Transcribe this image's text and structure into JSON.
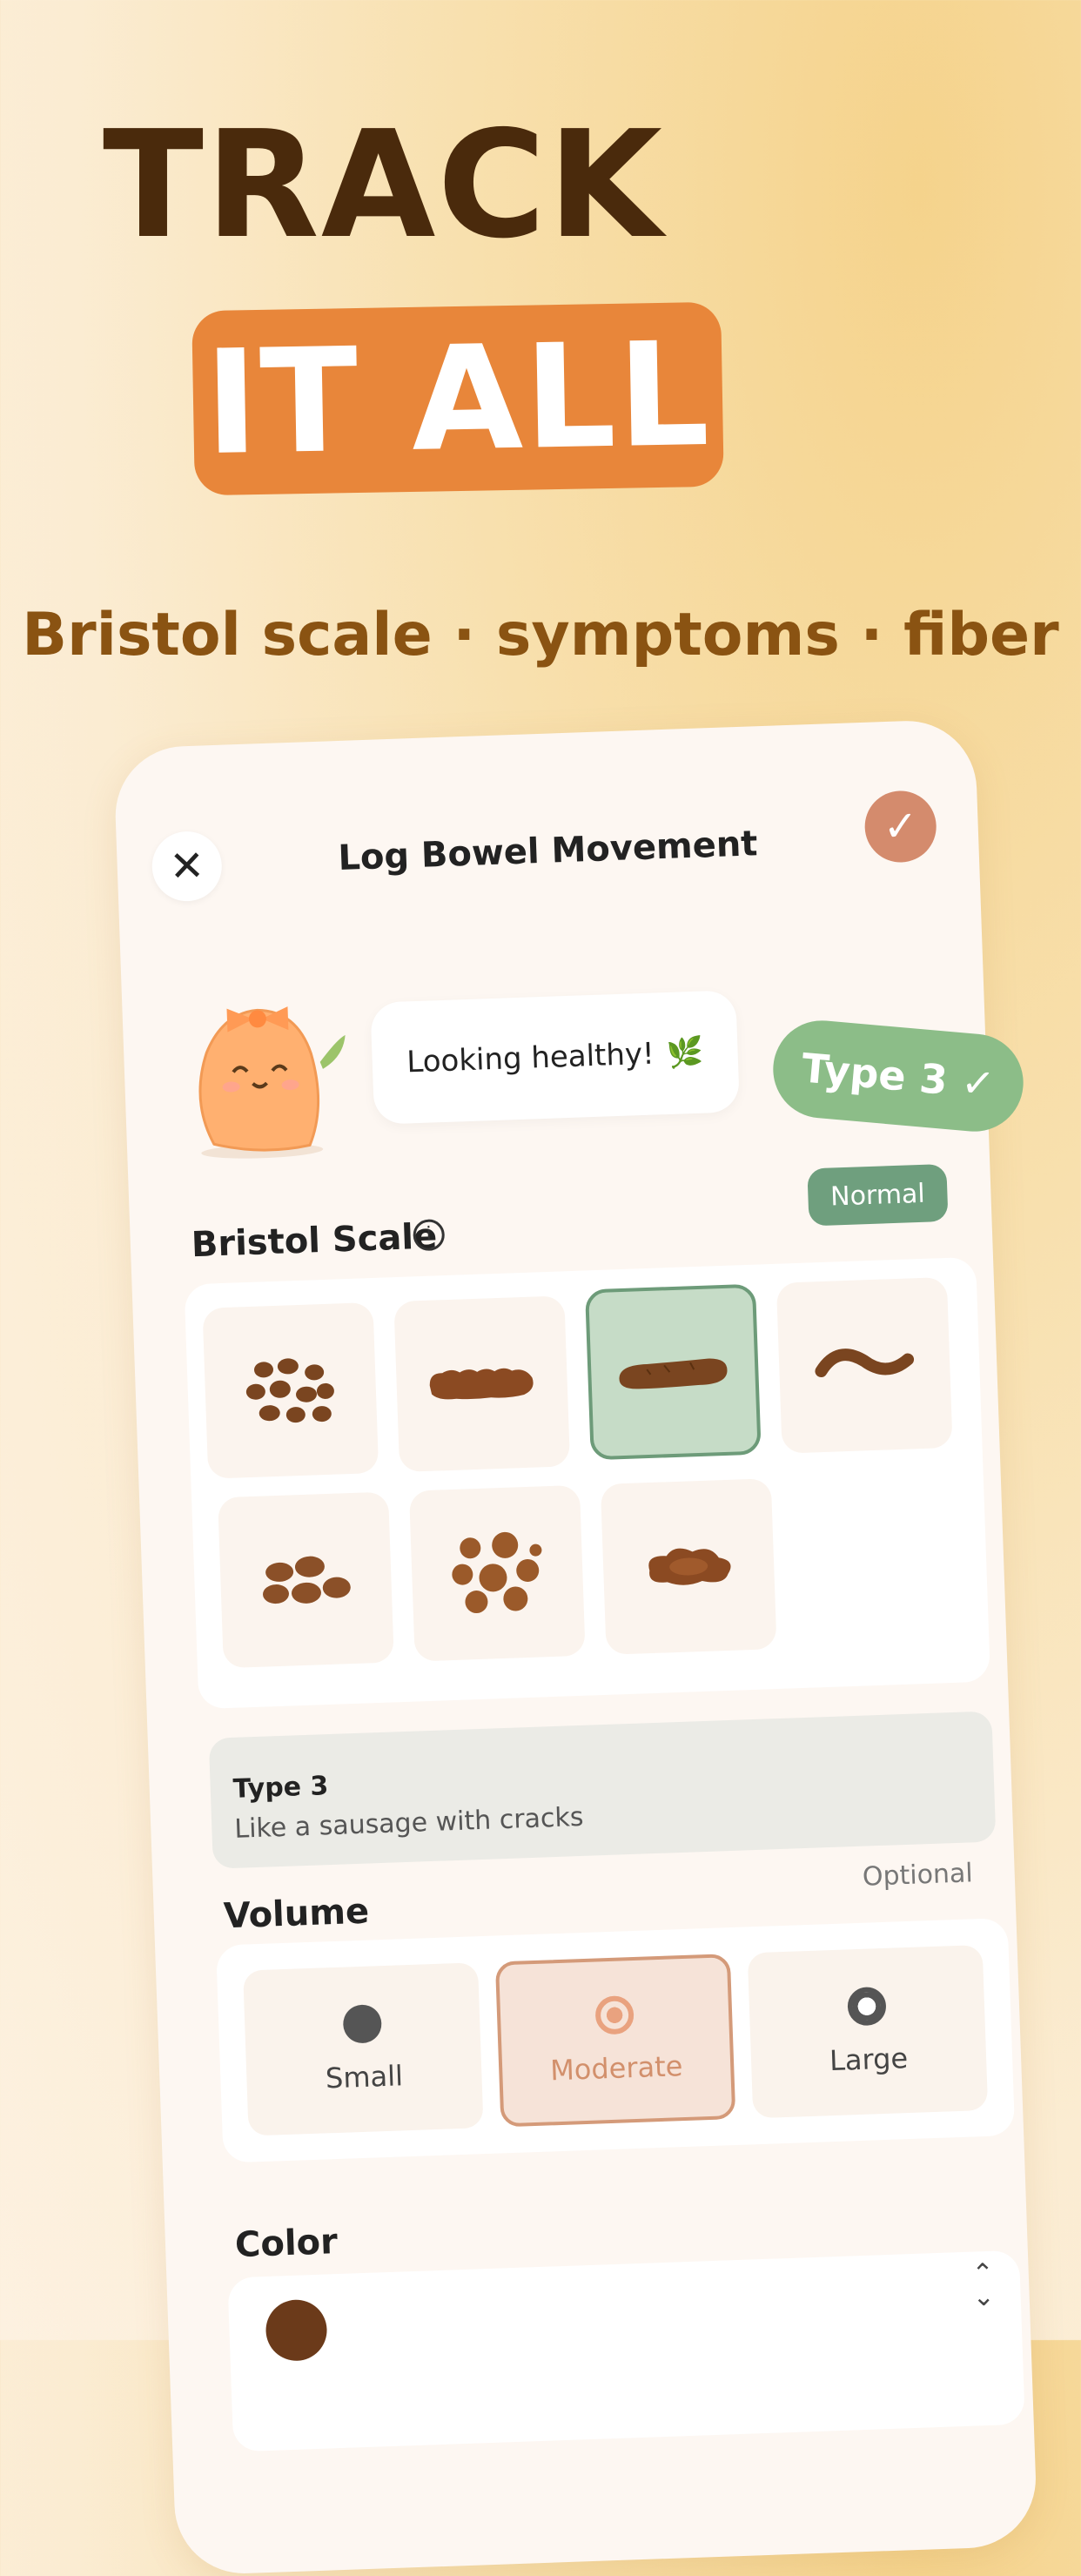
{
  "hero": {
    "headline": "TRACK",
    "highlight": "IT ALL",
    "subtitle": "Bristol scale · symptoms · fiber"
  },
  "colors": {
    "accent": "#e8863a",
    "headline": "#4a2a0c",
    "selected_green": "#c6dcc7",
    "selected_orange": "#f6e3d8"
  },
  "header": {
    "title": "Log Bowel Movement",
    "close_icon": "close-icon",
    "confirm_icon": "check-icon"
  },
  "mascot": {
    "message": "Looking healthy!",
    "leaf": "🌿"
  },
  "type_tag": "Type 3 ✓",
  "bristol": {
    "label": "Bristol Scale",
    "badge": "Normal",
    "types": [
      "Type 1",
      "Type 2",
      "Type 3",
      "Type 4",
      "Type 5",
      "Type 6",
      "Type 7"
    ],
    "selected": "Type 3",
    "description_title": "Type 3",
    "description_text": "Like a sausage with cracks"
  },
  "volume": {
    "label": "Volume",
    "optional": "Optional",
    "options": [
      "Small",
      "Moderate",
      "Large"
    ],
    "selected": "Moderate"
  },
  "color_section": {
    "label": "Color"
  }
}
